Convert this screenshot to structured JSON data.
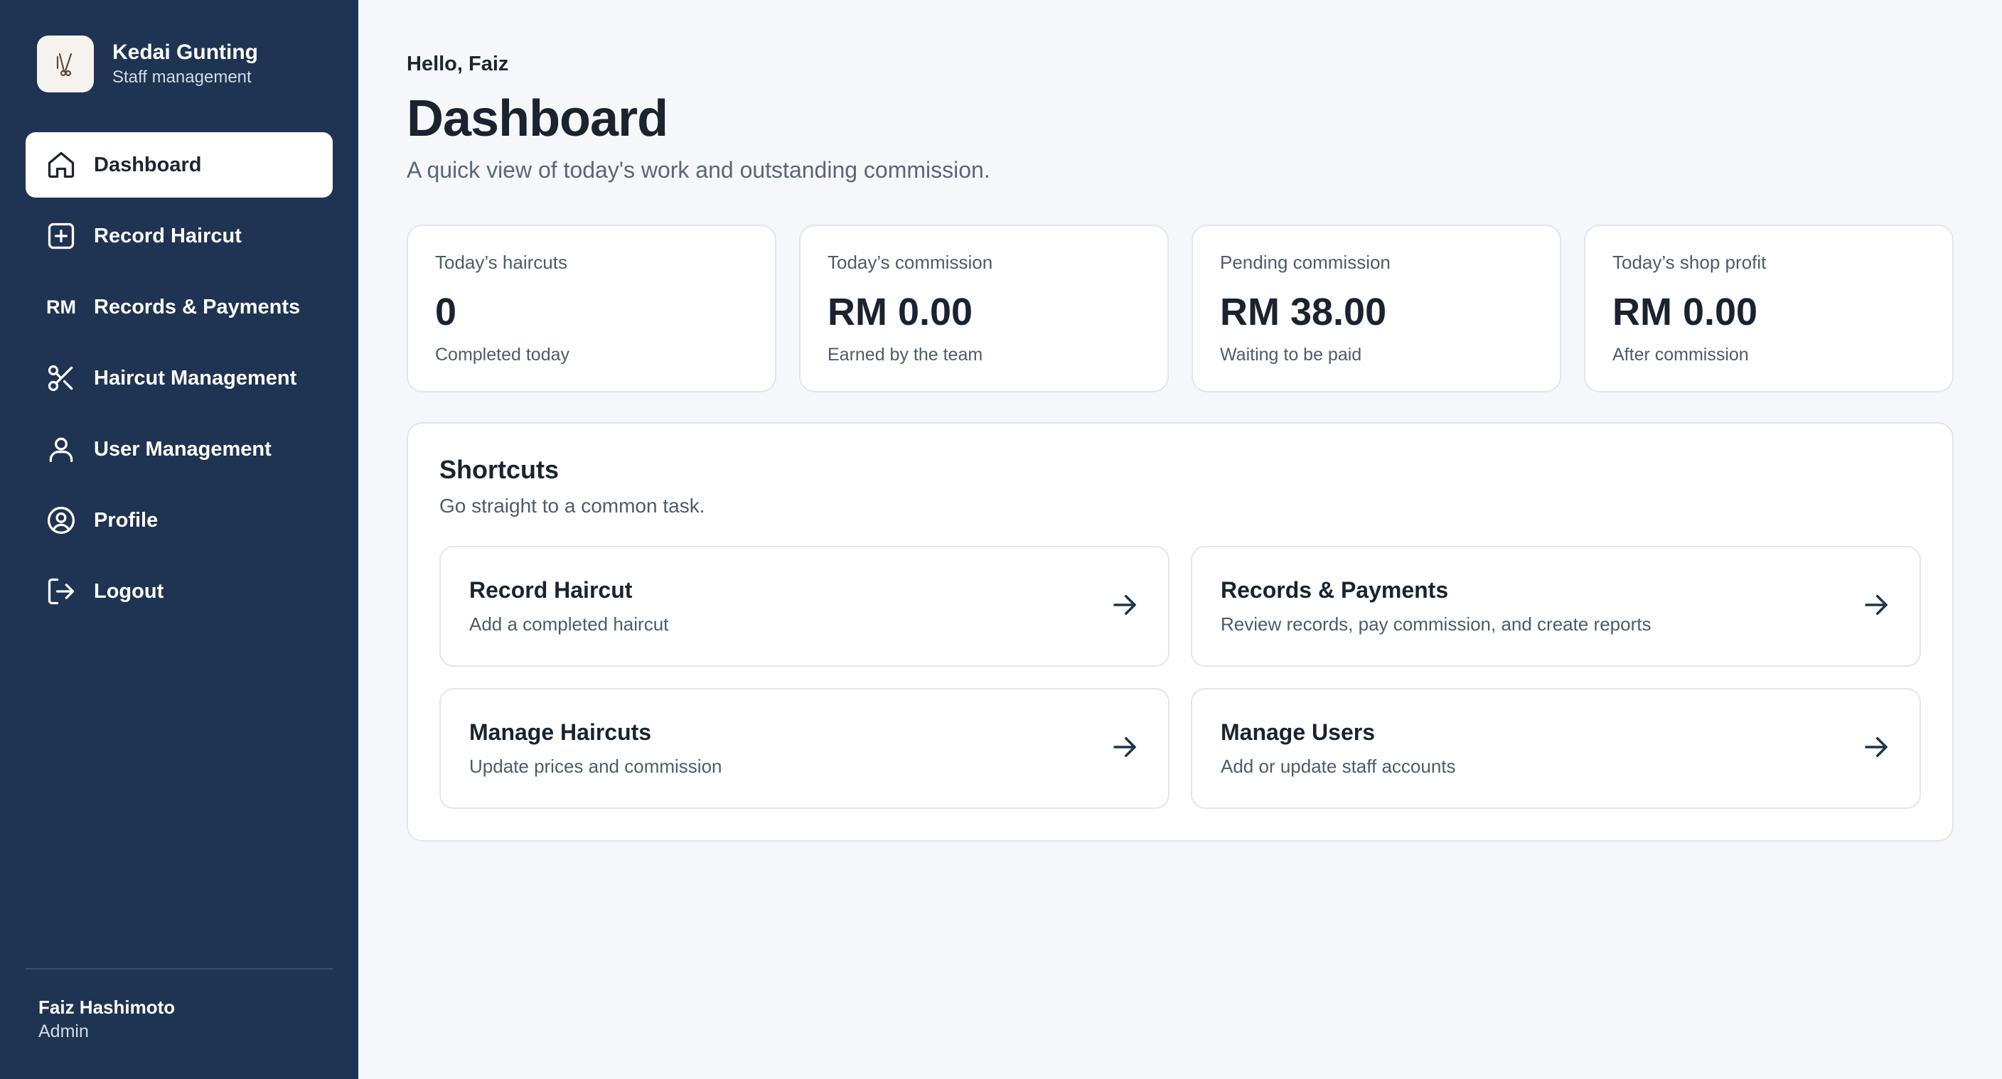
{
  "brand": {
    "name": "Kedai Gunting",
    "subtitle": "Staff management",
    "logo_icon": "barber-scissors-logo"
  },
  "sidebar": {
    "items": [
      {
        "label": "Dashboard",
        "icon": "home-icon",
        "active": true
      },
      {
        "label": "Record Haircut",
        "icon": "plus-square-icon"
      },
      {
        "label": "Records & Payments",
        "icon": "RM"
      },
      {
        "label": "Haircut Management",
        "icon": "scissors-icon"
      },
      {
        "label": "User Management",
        "icon": "user-icon"
      },
      {
        "label": "Profile",
        "icon": "user-circle-icon"
      },
      {
        "label": "Logout",
        "icon": "logout-icon"
      }
    ],
    "user": {
      "name": "Faiz Hashimoto",
      "role": "Admin"
    }
  },
  "header": {
    "greeting": "Hello, Faiz",
    "title": "Dashboard",
    "subtitle": "A quick view of today's work and outstanding commission."
  },
  "stats": [
    {
      "label": "Today’s haircuts",
      "value": "0",
      "caption": "Completed today"
    },
    {
      "label": "Today’s commission",
      "value": "RM 0.00",
      "caption": "Earned by the team"
    },
    {
      "label": "Pending commission",
      "value": "RM 38.00",
      "caption": "Waiting to be paid"
    },
    {
      "label": "Today’s shop profit",
      "value": "RM 0.00",
      "caption": "After commission"
    }
  ],
  "shortcuts": {
    "title": "Shortcuts",
    "subtitle": "Go straight to a common task.",
    "items": [
      {
        "title": "Record Haircut",
        "desc": "Add a completed haircut"
      },
      {
        "title": "Records & Payments",
        "desc": "Review records, pay commission, and create reports"
      },
      {
        "title": "Manage Haircuts",
        "desc": "Update prices and commission"
      },
      {
        "title": "Manage Users",
        "desc": "Add or update staff accounts"
      }
    ]
  },
  "colors": {
    "sidebar_bg": "#1f3352",
    "page_bg": "#f5f7fa",
    "card_border": "#e2e6ec",
    "text_dark": "#1b2230",
    "text_muted": "#4f5a6a"
  }
}
